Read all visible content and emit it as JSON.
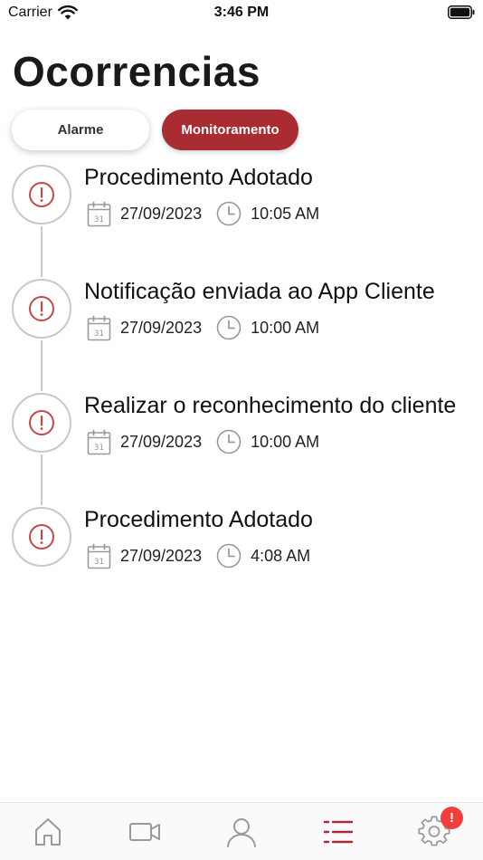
{
  "status_bar": {
    "carrier": "Carrier",
    "time": "3:46 PM"
  },
  "header": {
    "title": "Ocorrencias"
  },
  "tabs": [
    {
      "label": "Alarme",
      "active": false
    },
    {
      "label": "Monitoramento",
      "active": true
    }
  ],
  "events": [
    {
      "title": "Procedimento Adotado",
      "date": "27/09/2023",
      "time": "10:05 AM"
    },
    {
      "title": "Notificação enviada ao App Cliente",
      "date": "27/09/2023",
      "time": "10:00 AM"
    },
    {
      "title": "Realizar o reconhecimento do cliente",
      "date": "27/09/2023",
      "time": "10:00 AM"
    },
    {
      "title": "Procedimento Adotado",
      "date": "27/09/2023",
      "time": "4:08 AM"
    }
  ],
  "calendar_day": "31",
  "bottom_nav": {
    "items": [
      {
        "icon": "home-icon"
      },
      {
        "icon": "video-camera-icon"
      },
      {
        "icon": "user-icon"
      },
      {
        "icon": "list-icon",
        "active": true
      },
      {
        "icon": "gear-icon",
        "badge": "!"
      }
    ]
  },
  "colors": {
    "accent": "#a82c31",
    "alert_icon": "#c44a4a",
    "inactive_icon": "#9a9a9a",
    "badge": "#f23d3d"
  }
}
